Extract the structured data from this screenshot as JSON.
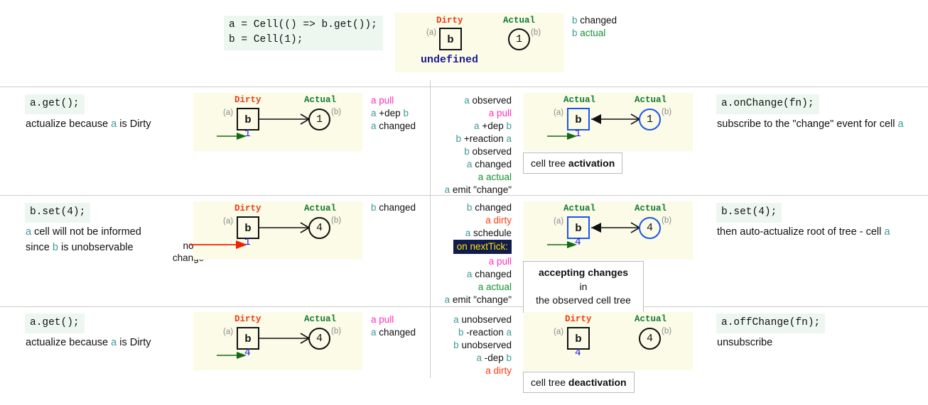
{
  "header": {
    "code_lines": [
      {
        "parts": [
          {
            "t": "a",
            "c": "ca"
          },
          {
            "t": " = ",
            "c": "pn"
          },
          {
            "t": "Cell",
            "c": "fn"
          },
          {
            "t": "((() => ",
            "c": "pn"
          },
          {
            "t": "b",
            "c": "cb"
          },
          {
            "t": ".",
            "c": "pn"
          },
          {
            "t": "get",
            "c": "fn"
          },
          {
            "t": "());",
            "c": "pn"
          }
        ]
      }
    ],
    "code_text": "a = Cell(() => b.get());\nb = Cell(1);",
    "diagram": {
      "left_label": "Dirty",
      "right_label": "Actual",
      "box_letter": "b",
      "box_tag": "(a)",
      "circle_value": "1",
      "circle_tag": "(b)",
      "under_text": "undefined"
    },
    "log": [
      {
        "text": "b changed",
        "ident": "b",
        "rest": " changed",
        "style": "plain"
      },
      {
        "text": "b actual",
        "ident": "b",
        "rest": " actual",
        "style": "actual"
      }
    ]
  },
  "rows": [
    {
      "left": {
        "code": "a.get();",
        "desc_pre": "actualize because ",
        "desc_ident": "a",
        "desc_post": " is Dirty"
      },
      "left_diagram": {
        "box_label": "Dirty",
        "box_label_kind": "dirty",
        "circle_label": "Actual",
        "box_letter": "b",
        "box_tag": "(a)",
        "circle_value": "1",
        "circle_tag": "(b)",
        "value": "1",
        "arrow": "right",
        "green_arrow": true,
        "red_arrow": false,
        "blue": false,
        "no_change": ""
      },
      "left_log": [
        {
          "ident": "a",
          "rest": " pull",
          "style": "pull"
        },
        {
          "ident": "a",
          "rest": " +dep ",
          "tail": "b",
          "style": "plain"
        },
        {
          "ident": "a",
          "rest": " changed",
          "style": "plain"
        }
      ],
      "right_log": [
        {
          "ident": "a",
          "rest": " observed",
          "style": "plain"
        },
        {
          "ident": "a",
          "rest": " pull",
          "style": "pull"
        },
        {
          "ident": "a",
          "rest": " +dep ",
          "tail": "b",
          "style": "plain"
        },
        {
          "ident": "b",
          "rest": " +reaction ",
          "tail": "a",
          "style": "plain"
        },
        {
          "ident": "b",
          "rest": " observed",
          "style": "plain"
        },
        {
          "ident": "a",
          "rest": " changed",
          "style": "plain"
        },
        {
          "ident": "a",
          "rest": " actual",
          "style": "actual"
        },
        {
          "ident": "a",
          "rest": " emit \"change\"",
          "style": "plain"
        }
      ],
      "right_diagram": {
        "box_label": "Actual",
        "box_label_kind": "actual",
        "circle_label": "Actual",
        "box_letter": "b",
        "box_tag": "(a)",
        "circle_value": "1",
        "circle_tag": "(b)",
        "value": "1",
        "arrow": "both",
        "green_arrow": true,
        "blue": true
      },
      "caption": {
        "pre": "cell tree ",
        "bold": "activation",
        "post": ""
      },
      "right": {
        "code": "a.onChange(fn);",
        "desc_pre": "subscribe to the \"change\" event for cell ",
        "desc_ident": "a",
        "desc_post": ""
      }
    },
    {
      "left": {
        "code": "b.set(4);",
        "desc_pre": "",
        "desc_ident": "a",
        "desc_post": " cell will not be informed"
      },
      "left_desc_line2_pre": "since ",
      "left_desc_line2_ident": "b",
      "left_desc_line2_post": " is unobservable",
      "left_diagram": {
        "box_label": "Dirty",
        "box_label_kind": "dirty",
        "circle_label": "Actual",
        "box_letter": "b",
        "box_tag": "(a)",
        "circle_value": "4",
        "circle_tag": "(b)",
        "value": "1",
        "arrow": "right",
        "green_arrow": false,
        "red_arrow": true,
        "blue": false,
        "no_change": "no\nchange"
      },
      "left_log": [
        {
          "ident": "b",
          "rest": " changed",
          "style": "plain"
        }
      ],
      "right_log": [
        {
          "ident": "b",
          "rest": " changed",
          "style": "plain"
        },
        {
          "ident": "a",
          "rest": " dirty",
          "style": "dirty"
        },
        {
          "ident": "a",
          "rest": " schedule",
          "style": "plain"
        },
        {
          "ident": "",
          "rest": "on nextTick:",
          "style": "tick"
        },
        {
          "ident": "a",
          "rest": " pull",
          "style": "pull"
        },
        {
          "ident": "a",
          "rest": " changed",
          "style": "plain"
        },
        {
          "ident": "a",
          "rest": " actual",
          "style": "actual"
        },
        {
          "ident": "a",
          "rest": " emit \"change\"",
          "style": "plain"
        }
      ],
      "right_diagram": {
        "box_label": "Actual",
        "box_label_kind": "actual",
        "circle_label": "Actual",
        "box_letter": "b",
        "box_tag": "(a)",
        "circle_value": "4",
        "circle_tag": "(b)",
        "value": "4",
        "arrow": "both",
        "green_arrow": true,
        "blue": true
      },
      "caption": {
        "line1": "accepting changes",
        "line2": "in",
        "line3": "the observed cell tree"
      },
      "right": {
        "code": "b.set(4);",
        "desc_pre": "then auto-actualize root of tree - cell ",
        "desc_ident": "a",
        "desc_post": ""
      }
    },
    {
      "left": {
        "code": "a.get();",
        "desc_pre": "actualize because ",
        "desc_ident": "a",
        "desc_post": " is Dirty"
      },
      "left_diagram": {
        "box_label": "Dirty",
        "box_label_kind": "dirty",
        "circle_label": "Actual",
        "box_letter": "b",
        "box_tag": "(a)",
        "circle_value": "4",
        "circle_tag": "(b)",
        "value": "4",
        "arrow": "right",
        "green_arrow": true,
        "red_arrow": false,
        "blue": false,
        "no_change": ""
      },
      "left_log": [
        {
          "ident": "a",
          "rest": " pull",
          "style": "pull"
        },
        {
          "ident": "a",
          "rest": " changed",
          "style": "plain"
        }
      ],
      "right_log": [
        {
          "ident": "a",
          "rest": " unobserved",
          "style": "plain"
        },
        {
          "ident": "b",
          "rest": " -reaction ",
          "tail": "a",
          "style": "plain"
        },
        {
          "ident": "b",
          "rest": " unobserved",
          "style": "plain"
        },
        {
          "ident": "a",
          "rest": " -dep ",
          "tail": "b",
          "style": "plain"
        },
        {
          "ident": "a",
          "rest": " dirty",
          "style": "dirty"
        }
      ],
      "right_diagram": {
        "box_label": "Dirty",
        "box_label_kind": "dirty",
        "circle_label": "Actual",
        "box_letter": "b",
        "box_tag": "(a)",
        "circle_value": "4",
        "circle_tag": "(b)",
        "value": "4",
        "arrow": "none",
        "green_arrow": false,
        "blue": false
      },
      "caption": {
        "pre": "cell tree ",
        "bold": "deactivation",
        "post": ""
      },
      "right": {
        "code": "a.offChange(fn);",
        "desc_pre": "unsubscribe",
        "desc_ident": "",
        "desc_post": ""
      }
    }
  ],
  "colors": {
    "dirty": "#ee3b11",
    "actual": "#117a33",
    "pull": "#ff2fc2",
    "blue_node": "#1a56e8",
    "value_blue": "#2222dd",
    "panel_bg": "#fbfbe8",
    "code_bg": "#eef7ef",
    "tick_bg": "#101b4e",
    "tick_fg": "#ffe600",
    "ident": "#3d9a9a"
  }
}
